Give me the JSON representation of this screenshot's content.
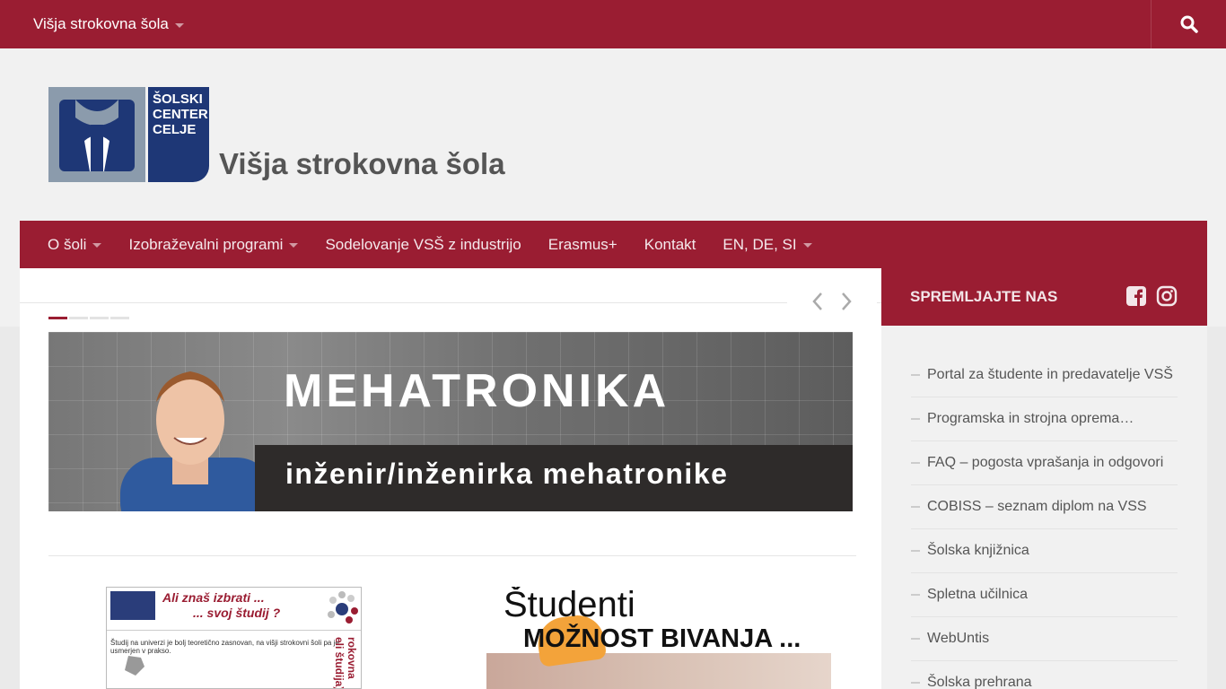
{
  "topbar": {
    "site_menu_label": "Višja strokovna šola",
    "search_icon": "search-icon"
  },
  "logo": {
    "badge_lines": [
      "ŠOLSKI",
      "CENTER",
      "CELJE"
    ],
    "title": "Višja strokovna šola"
  },
  "nav": {
    "items": [
      {
        "label": "O šoli",
        "has_dropdown": true
      },
      {
        "label": "Izobraževalni programi",
        "has_dropdown": true
      },
      {
        "label": "Sodelovanje VSŠ z industrijo",
        "has_dropdown": false
      },
      {
        "label": "Erasmus+",
        "has_dropdown": false
      },
      {
        "label": "Kontakt",
        "has_dropdown": false
      },
      {
        "label": "EN, DE, SI",
        "has_dropdown": true
      }
    ]
  },
  "slider": {
    "banner_title": "MEHATRONIKA",
    "banner_subtitle": "inženir/inženirka mehatronike",
    "dot_count": 4,
    "active_dot": 1
  },
  "posts": {
    "thumb1": {
      "line1": "Ali znaš izbrati ...",
      "line2": "... svoj študij ?",
      "body": "Študij na univerzi je bolj teoretično zasnovan, na višji strokovni šoli pa je usmerjen v prakso.",
      "side": "rokovna eli študija)"
    },
    "thumb2": {
      "line1": "Študenti",
      "line2": "MOŽNOST BIVANJA ..."
    }
  },
  "sidebar": {
    "follow_title": "SPREMLJAJTE NAS",
    "social_icons": [
      "facebook-icon",
      "instagram-icon"
    ],
    "links": [
      "Portal za študente in predavatelje VSŠ",
      "Programska in strojna oprema…",
      "FAQ – pogosta vprašanja in odgovori",
      "COBISS – seznam diplom na VSS",
      "Šolska knjižnica",
      "Spletna učilnica",
      "WebUntis",
      "Šolska prehrana"
    ]
  },
  "colors": {
    "brand": "#9a1d32",
    "logo_navy": "#1e3776",
    "logo_grey": "#8b9bac"
  }
}
